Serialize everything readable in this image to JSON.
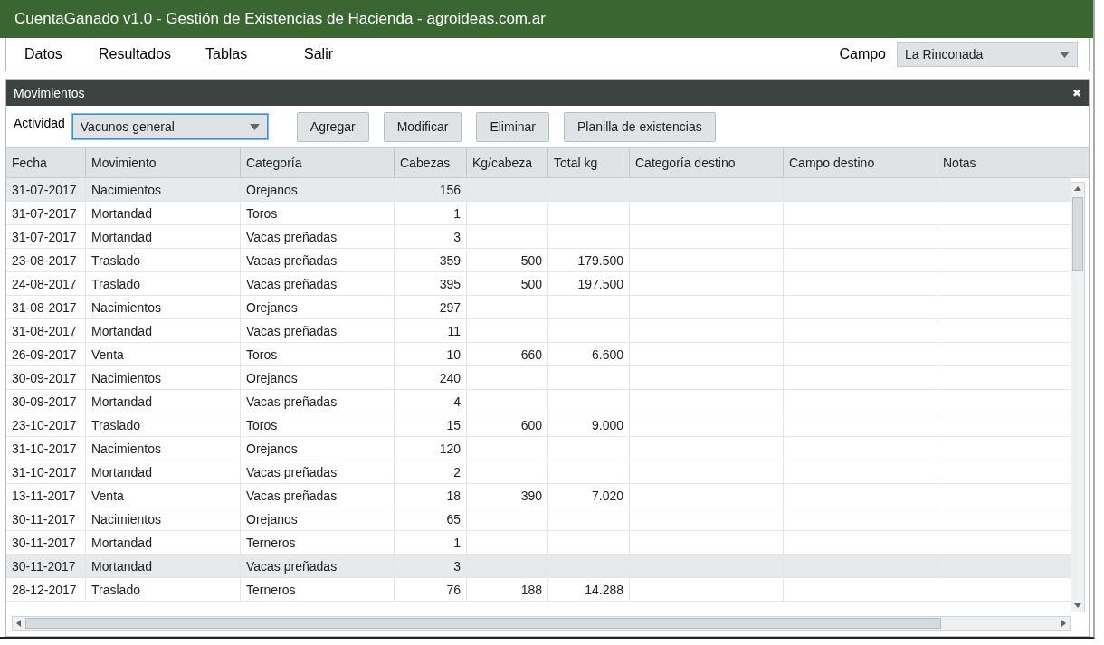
{
  "window": {
    "title": "CuentaGanado v1.0 - Gestión de Existencias de Hacienda - agroideas.com.ar"
  },
  "menu": [
    "Datos",
    "Resultados",
    "Tablas",
    "Salir"
  ],
  "campo": {
    "label": "Campo",
    "value": "La Rinconada"
  },
  "panel": {
    "title": "Movimientos",
    "close": "✖"
  },
  "actividad": {
    "label": "Actividad",
    "value": "Vacunos general"
  },
  "buttons": [
    "Agregar",
    "Modificar",
    "Eliminar",
    "Planilla de existencias"
  ],
  "table": {
    "columns": [
      "Fecha",
      "Movimiento",
      "Categoría",
      "Cabezas",
      "Kg/cabeza",
      "Total kg",
      "Categoría destino",
      "Campo destino",
      "Notas"
    ],
    "rows": [
      {
        "cells": [
          "31-07-2017",
          "Nacimientos",
          "Orejanos",
          "156",
          "",
          "",
          "",
          "",
          ""
        ],
        "selected": true
      },
      {
        "cells": [
          "31-07-2017",
          "Mortandad",
          "Toros",
          "1",
          "",
          "",
          "",
          "",
          ""
        ],
        "selected": false
      },
      {
        "cells": [
          "31-07-2017",
          "Mortandad",
          "Vacas preñadas",
          "3",
          "",
          "",
          "",
          "",
          ""
        ],
        "selected": false
      },
      {
        "cells": [
          "23-08-2017",
          "Traslado",
          "Vacas preñadas",
          "359",
          "500",
          "179.500",
          "",
          "",
          ""
        ],
        "selected": false
      },
      {
        "cells": [
          "24-08-2017",
          "Traslado",
          "Vacas preñadas",
          "395",
          "500",
          "197.500",
          "",
          "",
          ""
        ],
        "selected": false
      },
      {
        "cells": [
          "31-08-2017",
          "Nacimientos",
          "Orejanos",
          "297",
          "",
          "",
          "",
          "",
          ""
        ],
        "selected": false
      },
      {
        "cells": [
          "31-08-2017",
          "Mortandad",
          "Vacas preñadas",
          "11",
          "",
          "",
          "",
          "",
          ""
        ],
        "selected": false
      },
      {
        "cells": [
          "26-09-2017",
          "Venta",
          "Toros",
          "10",
          "660",
          "6.600",
          "",
          "",
          ""
        ],
        "selected": false
      },
      {
        "cells": [
          "30-09-2017",
          "Nacimientos",
          "Orejanos",
          "240",
          "",
          "",
          "",
          "",
          ""
        ],
        "selected": false
      },
      {
        "cells": [
          "30-09-2017",
          "Mortandad",
          "Vacas preñadas",
          "4",
          "",
          "",
          "",
          "",
          ""
        ],
        "selected": false
      },
      {
        "cells": [
          "23-10-2017",
          "Traslado",
          "Toros",
          "15",
          "600",
          "9.000",
          "",
          "",
          ""
        ],
        "selected": false
      },
      {
        "cells": [
          "31-10-2017",
          "Nacimientos",
          "Orejanos",
          "120",
          "",
          "",
          "",
          "",
          ""
        ],
        "selected": false
      },
      {
        "cells": [
          "31-10-2017",
          "Mortandad",
          "Vacas preñadas",
          "2",
          "",
          "",
          "",
          "",
          ""
        ],
        "selected": false
      },
      {
        "cells": [
          "13-11-2017",
          "Venta",
          "Vacas preñadas",
          "18",
          "390",
          "7.020",
          "",
          "",
          ""
        ],
        "selected": false
      },
      {
        "cells": [
          "30-11-2017",
          "Nacimientos",
          "Orejanos",
          "65",
          "",
          "",
          "",
          "",
          ""
        ],
        "selected": false
      },
      {
        "cells": [
          "30-11-2017",
          "Mortandad",
          "Terneros",
          "1",
          "",
          "",
          "",
          "",
          ""
        ],
        "selected": false
      },
      {
        "cells": [
          "30-11-2017",
          "Mortandad",
          "Vacas preñadas",
          "3",
          "",
          "",
          "",
          "",
          ""
        ],
        "selected": true
      },
      {
        "cells": [
          "28-12-2017",
          "Traslado",
          "Terneros",
          "76",
          "188",
          "14.288",
          "",
          "",
          ""
        ],
        "selected": false
      }
    ]
  }
}
